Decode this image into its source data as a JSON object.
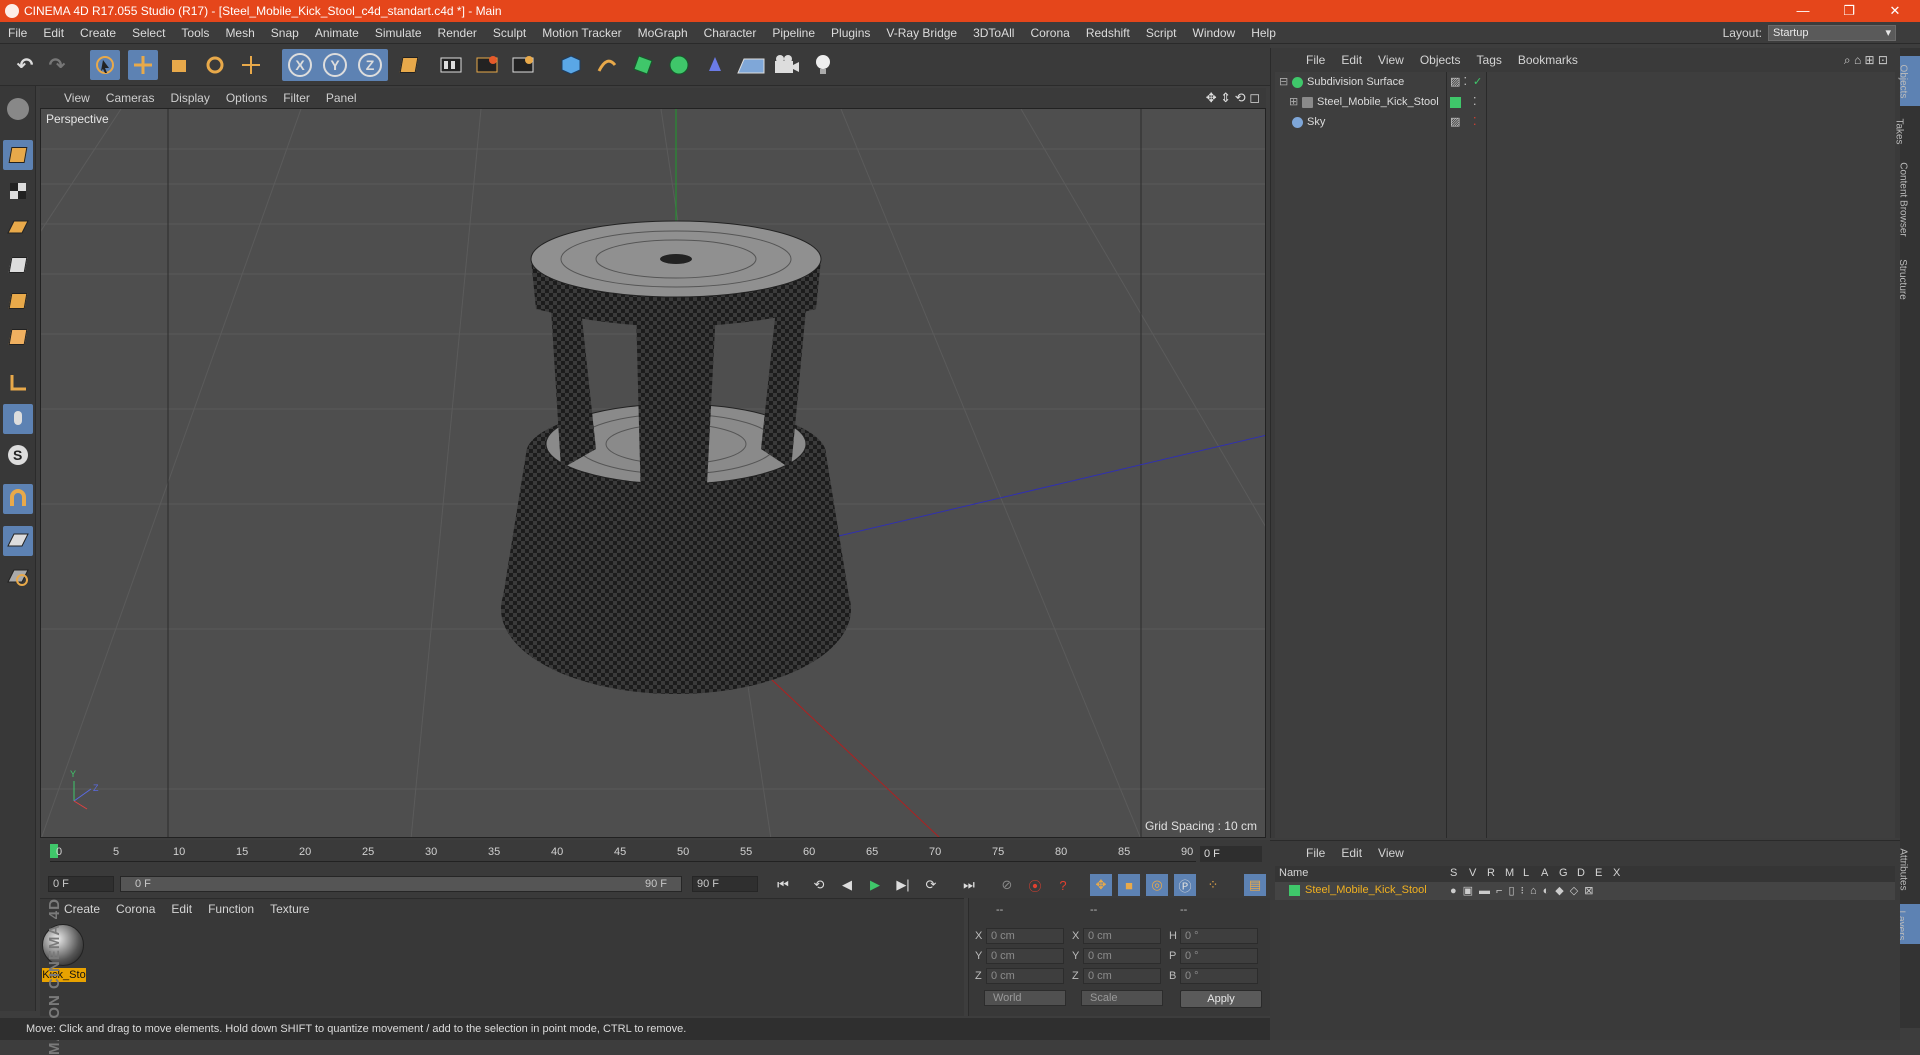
{
  "window": {
    "title": "CINEMA 4D R17.055 Studio (R17) - [Steel_Mobile_Kick_Stool_c4d_standart.c4d *] - Main",
    "minimize": "—",
    "maximize": "❐",
    "close": "✕"
  },
  "menu": [
    "File",
    "Edit",
    "Create",
    "Select",
    "Tools",
    "Mesh",
    "Snap",
    "Animate",
    "Simulate",
    "Render",
    "Sculpt",
    "Motion Tracker",
    "MoGraph",
    "Character",
    "Pipeline",
    "Plugins",
    "V-Ray Bridge",
    "3DToAll",
    "Corona",
    "Redshift",
    "Script",
    "Window",
    "Help"
  ],
  "layout": {
    "label": "Layout:",
    "value": "Startup"
  },
  "toolbar": {
    "x_axis": "X",
    "y_axis": "Y",
    "z_axis": "Z"
  },
  "viewport": {
    "menu": [
      "View",
      "Cameras",
      "Display",
      "Options",
      "Filter",
      "Panel"
    ],
    "label": "Perspective",
    "grid_spacing": "Grid Spacing : 10 cm"
  },
  "timeline": {
    "ticks": [
      "0",
      "5",
      "10",
      "15",
      "20",
      "25",
      "30",
      "35",
      "40",
      "45",
      "50",
      "55",
      "60",
      "65",
      "70",
      "75",
      "80",
      "85",
      "90"
    ],
    "current_frame": "0 F",
    "start_field": "0 F",
    "range_start": "0 F",
    "range_end": "90 F",
    "end_field": "90 F"
  },
  "material_panel": {
    "menu": [
      "Create",
      "Corona",
      "Edit",
      "Function",
      "Texture"
    ],
    "material_name": "Kick_Sto"
  },
  "coordinates": {
    "headers": [
      "--",
      "--",
      "--"
    ],
    "rows": [
      {
        "a": "X",
        "a_val": "0 cm",
        "b": "X",
        "b_val": "0 cm",
        "c": "H",
        "c_val": "0 °"
      },
      {
        "a": "Y",
        "a_val": "0 cm",
        "b": "Y",
        "b_val": "0 cm",
        "c": "P",
        "c_val": "0 °"
      },
      {
        "a": "Z",
        "a_val": "0 cm",
        "b": "Z",
        "b_val": "0 cm",
        "c": "B",
        "c_val": "0 °"
      }
    ],
    "space": "World",
    "mode": "Scale",
    "apply": "Apply"
  },
  "status": "Move: Click and drag to move elements. Hold down SHIFT to quantize movement / add to the selection in point mode, CTRL to remove.",
  "brand": "MAXON CINEMA 4D",
  "object_manager": {
    "menu": [
      "File",
      "Edit",
      "View",
      "Objects",
      "Tags",
      "Bookmarks"
    ],
    "objects": [
      {
        "name": "Subdivision Surface",
        "color": "#3fc76a"
      },
      {
        "name": "Steel_Mobile_Kick_Stool",
        "color": "#8a8a8a"
      },
      {
        "name": "Sky",
        "color": "#7ea6d8"
      }
    ]
  },
  "right_tabs": [
    "Objects",
    "Takes",
    "Content Browser",
    "Structure",
    "Attributes",
    "Layers"
  ],
  "layer_manager": {
    "menu": [
      "File",
      "Edit",
      "View"
    ],
    "columns": [
      "Name",
      "S",
      "V",
      "R",
      "M",
      "L",
      "A",
      "G",
      "D",
      "E",
      "X"
    ],
    "layer": "Steel_Mobile_Kick_Stool",
    "layer_color": "#3fc76a"
  }
}
